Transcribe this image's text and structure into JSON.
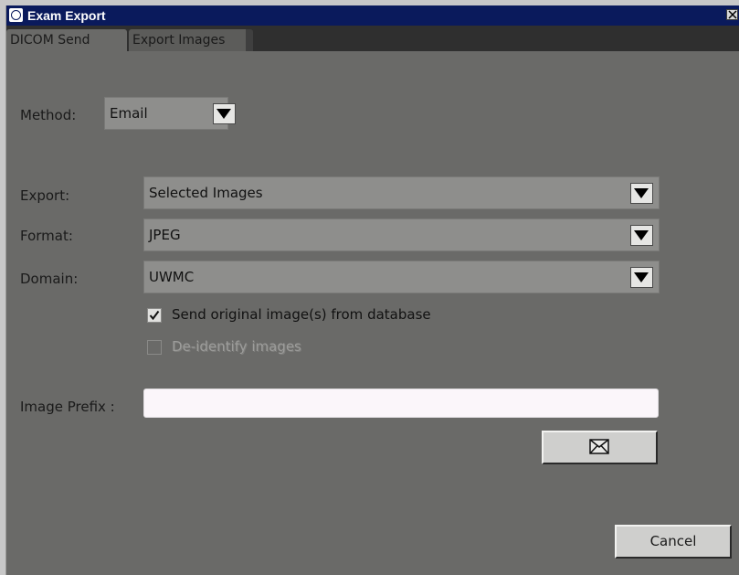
{
  "window": {
    "title": "Exam Export"
  },
  "tabs": [
    {
      "label": "DICOM Send"
    },
    {
      "label": "Export Images"
    }
  ],
  "method": {
    "label": "Method:",
    "value": "Email"
  },
  "export": {
    "label": "Export:",
    "value": "Selected Images"
  },
  "format": {
    "label": "Format:",
    "value": "JPEG"
  },
  "domain": {
    "label": "Domain:",
    "value": "UWMC"
  },
  "options": {
    "send_original": {
      "label": "Send original image(s) from database",
      "checked": true
    },
    "deidentify": {
      "label": "De-identify images",
      "checked": false,
      "disabled": true
    }
  },
  "prefix": {
    "label": "Image  Prefix :",
    "value": ""
  },
  "buttons": {
    "send_icon": "envelope-icon",
    "cancel_label": "Cancel"
  },
  "colors": {
    "titlebar": "#0a1a5c",
    "panel": "#6a6a68",
    "field": "#8e8e8c",
    "input": "#fbf6fa"
  }
}
